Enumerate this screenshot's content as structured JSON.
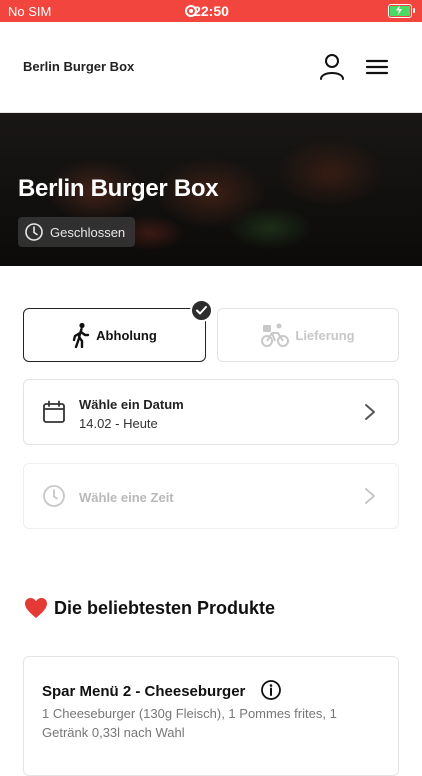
{
  "status_bar": {
    "carrier": "No SIM",
    "time": "22:50"
  },
  "header": {
    "title": "Berlin Burger Box"
  },
  "hero": {
    "title": "Berlin Burger Box",
    "status": "Geschlossen"
  },
  "mode": {
    "pickup_label": "Abholung",
    "delivery_label": "Lieferung",
    "selected": "pickup"
  },
  "date_selector": {
    "label": "Wähle ein Datum",
    "value": "14.02 - Heute"
  },
  "time_selector": {
    "label": "Wähle eine Zeit"
  },
  "popular": {
    "title": "Die beliebtesten Produkte",
    "products": [
      {
        "name": "Spar Menü 2 - Cheeseburger",
        "description": "1 Cheeseburger (130g Fleisch), 1 Pommes frites, 1 Getränk 0,33l nach Wahl",
        "price": ""
      }
    ]
  },
  "colors": {
    "status_bar": "#f2453d",
    "accent": "#2d2d2d",
    "heart": "#e53935"
  }
}
